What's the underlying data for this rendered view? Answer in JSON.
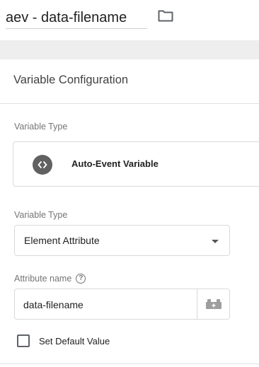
{
  "header": {
    "title_value": "aev - data-filename",
    "folder_icon": "folder-icon"
  },
  "card": {
    "title": "Variable Configuration",
    "variable_type_section": {
      "label": "Variable Type",
      "selected_type": "Auto-Event Variable",
      "type_icon": "code-icon"
    },
    "element_type_section": {
      "label": "Variable Type",
      "selected_value": "Element Attribute"
    },
    "attribute_section": {
      "label": "Attribute name",
      "help_glyph": "?",
      "input_value": "data-filename",
      "variable_picker_icon": "lego-brick-icon"
    },
    "default_value": {
      "label": "Set Default Value",
      "checked": false
    }
  }
}
